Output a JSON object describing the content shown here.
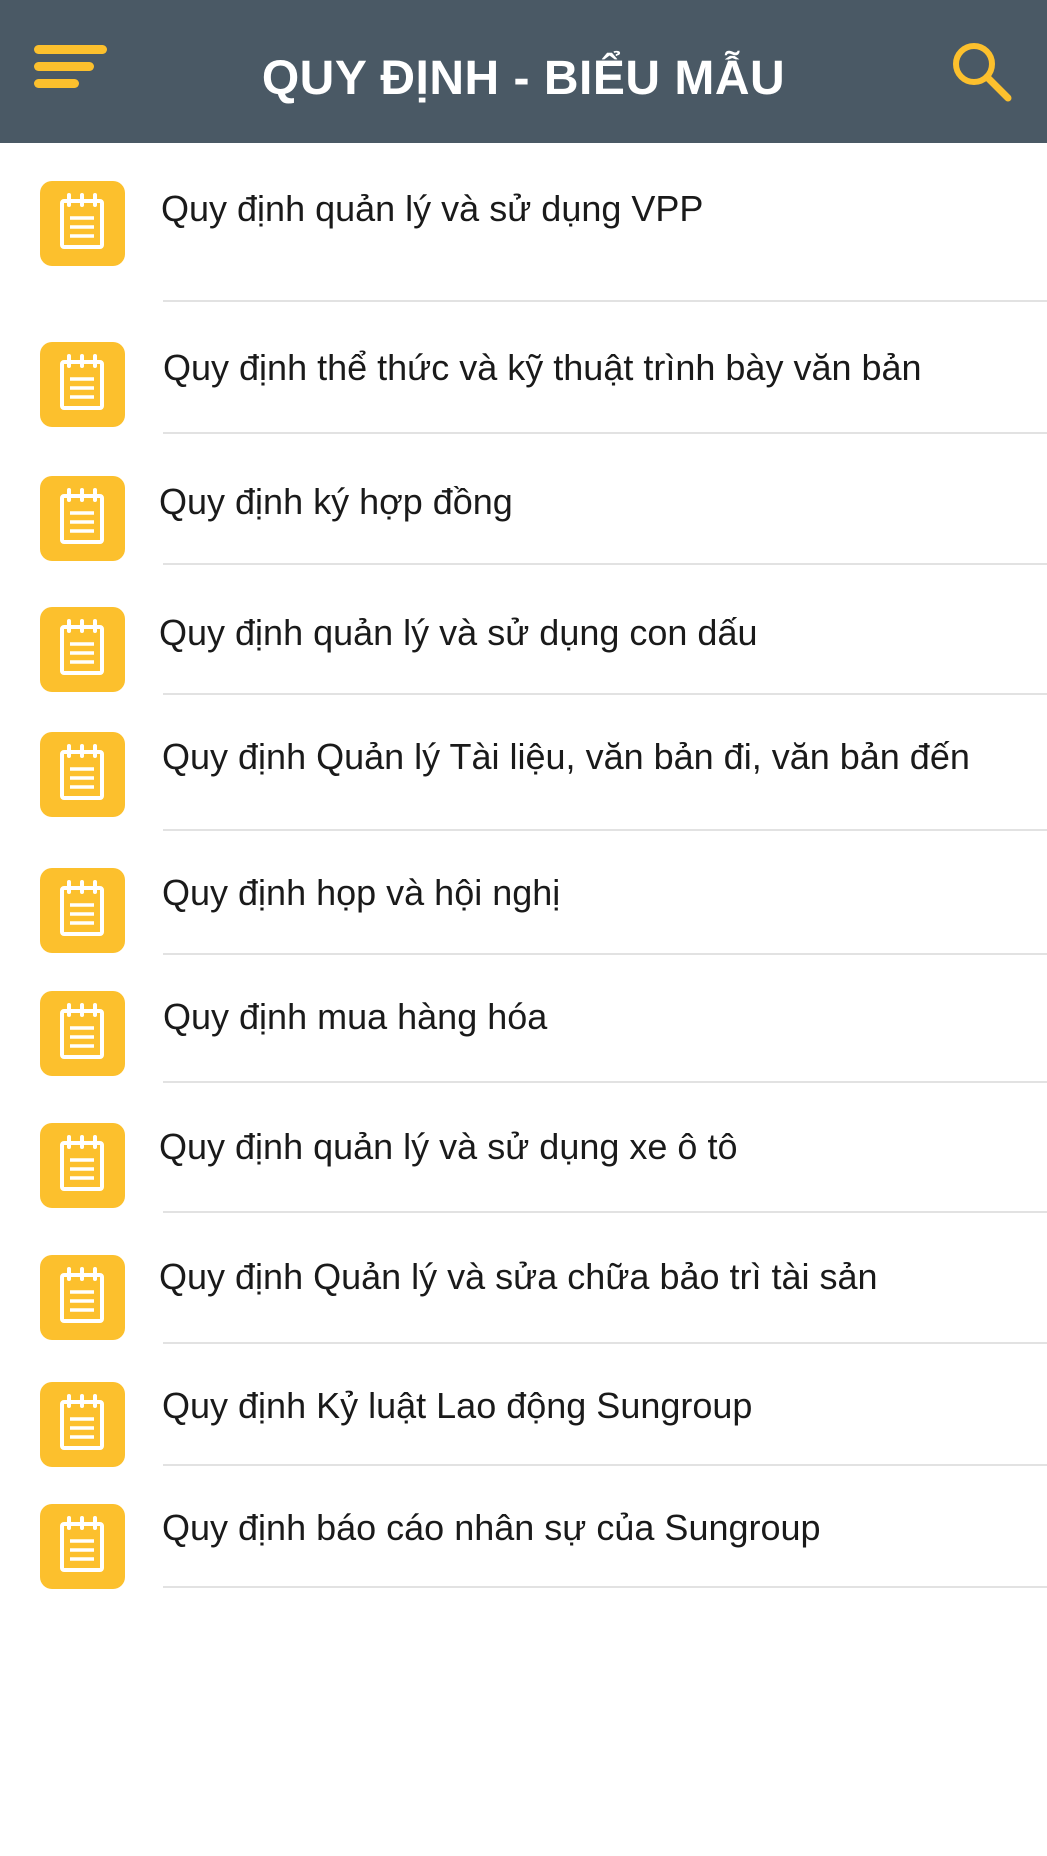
{
  "header": {
    "title": "QUY ĐỊNH - BIỂU MẪU",
    "menu_icon": "hamburger-menu-icon",
    "search_icon": "search-icon",
    "background_color": "#4a5965",
    "accent_color": "#fcc02d"
  },
  "list": {
    "item_icon": "document-icon",
    "items": [
      {
        "label": "Quy định quản lý và sử dụng VPP"
      },
      {
        "label": "Quy định thể thức và kỹ thuật trình bày văn bản"
      },
      {
        "label": "Quy định ký hợp đồng"
      },
      {
        "label": "Quy định quản lý và sử dụng con dấu"
      },
      {
        "label": "Quy định Quản lý Tài liệu, văn bản đi, văn bản đến"
      },
      {
        "label": "Quy định họp và hội nghị"
      },
      {
        "label": "Quy định mua hàng hóa"
      },
      {
        "label": "Quy định quản lý và sử dụng xe ô tô"
      },
      {
        "label": "Quy định Quản lý và sửa chữa bảo trì tài sản"
      },
      {
        "label": "Quy định Kỷ luật Lao động Sungroup"
      },
      {
        "label": "Quy định báo cáo nhân sự của Sungroup"
      }
    ]
  }
}
